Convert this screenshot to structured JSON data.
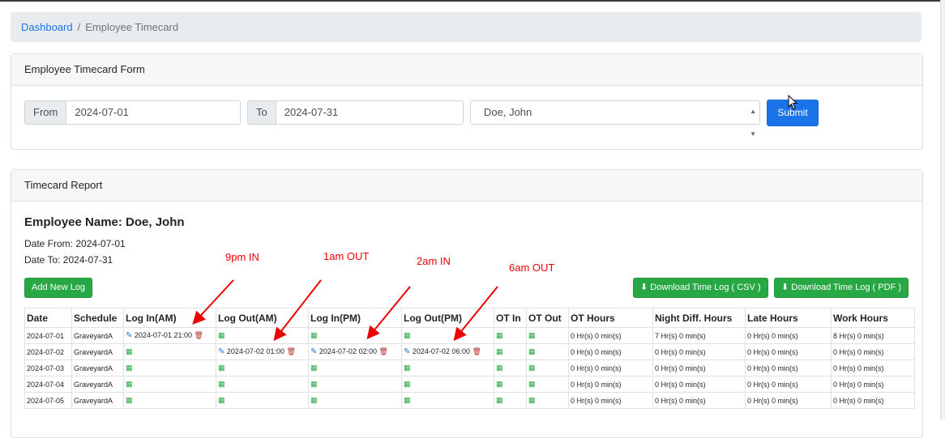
{
  "breadcrumb": {
    "home": "Dashboard",
    "current": "Employee Timecard"
  },
  "form": {
    "title": "Employee Timecard Form",
    "from_label": "From",
    "from_value": "2024-07-01",
    "to_label": "To",
    "to_value": "2024-07-31",
    "employee_value": "Doe, John",
    "submit_label": "Submit"
  },
  "report": {
    "title": "Timecard Report",
    "employee_name": "Employee Name: Doe, John",
    "date_from": "Date From: 2024-07-01",
    "date_to": "Date To: 2024-07-31",
    "add_button": "Add New Log",
    "csv_button": "Download Time Log ( CSV )",
    "pdf_button": "Download Time Log ( PDF )"
  },
  "annotations": [
    "9pm IN",
    "1am OUT",
    "2am IN",
    "6am OUT"
  ],
  "table": {
    "headers": [
      "Date",
      "Schedule",
      "Log In(AM)",
      "Log Out(AM)",
      "Log In(PM)",
      "Log Out(PM)",
      "OT In",
      "OT Out",
      "OT Hours",
      "Night Diff. Hours",
      "Late Hours",
      "Work Hours"
    ],
    "rows": [
      {
        "date": "2024-07-01",
        "schedule": "GraveyardA",
        "login_am": "2024-07-01 21:00",
        "logout_am": "",
        "login_pm": "",
        "logout_pm": "",
        "ot_hours": "0 Hr(s) 0 min(s)",
        "nd_hours": "7 Hr(s) 0 min(s)",
        "late_hours": "0 Hr(s) 0 min(s)",
        "work_hours": "8 Hr(s) 0 min(s)"
      },
      {
        "date": "2024-07-02",
        "schedule": "GraveyardA",
        "login_am": "",
        "logout_am": "2024-07-02 01:00",
        "login_pm": "2024-07-02 02:00",
        "logout_pm": "2024-07-02 06:00",
        "ot_hours": "0 Hr(s) 0 min(s)",
        "nd_hours": "0 Hr(s) 0 min(s)",
        "late_hours": "0 Hr(s) 0 min(s)",
        "work_hours": "0 Hr(s) 0 min(s)"
      },
      {
        "date": "2024-07-03",
        "schedule": "GraveyardA",
        "login_am": "",
        "logout_am": "",
        "login_pm": "",
        "logout_pm": "",
        "ot_hours": "0 Hr(s) 0 min(s)",
        "nd_hours": "0 Hr(s) 0 min(s)",
        "late_hours": "0 Hr(s) 0 min(s)",
        "work_hours": "0 Hr(s) 0 min(s)"
      },
      {
        "date": "2024-07-04",
        "schedule": "GraveyardA",
        "login_am": "",
        "logout_am": "",
        "login_pm": "",
        "logout_pm": "",
        "ot_hours": "0 Hr(s) 0 min(s)",
        "nd_hours": "0 Hr(s) 0 min(s)",
        "late_hours": "0 Hr(s) 0 min(s)",
        "work_hours": "0 Hr(s) 0 min(s)"
      },
      {
        "date": "2024-07-05",
        "schedule": "GraveyardA",
        "login_am": "",
        "logout_am": "",
        "login_pm": "",
        "logout_pm": "",
        "ot_hours": "0 Hr(s) 0 min(s)",
        "nd_hours": "0 Hr(s) 0 min(s)",
        "late_hours": "0 Hr(s) 0 min(s)",
        "work_hours": "0 Hr(s) 0 min(s)"
      }
    ]
  },
  "colors": {
    "primary": "#1a73e8",
    "success": "#28a745",
    "danger": "#b52a2a",
    "annotation": "#e00000"
  }
}
